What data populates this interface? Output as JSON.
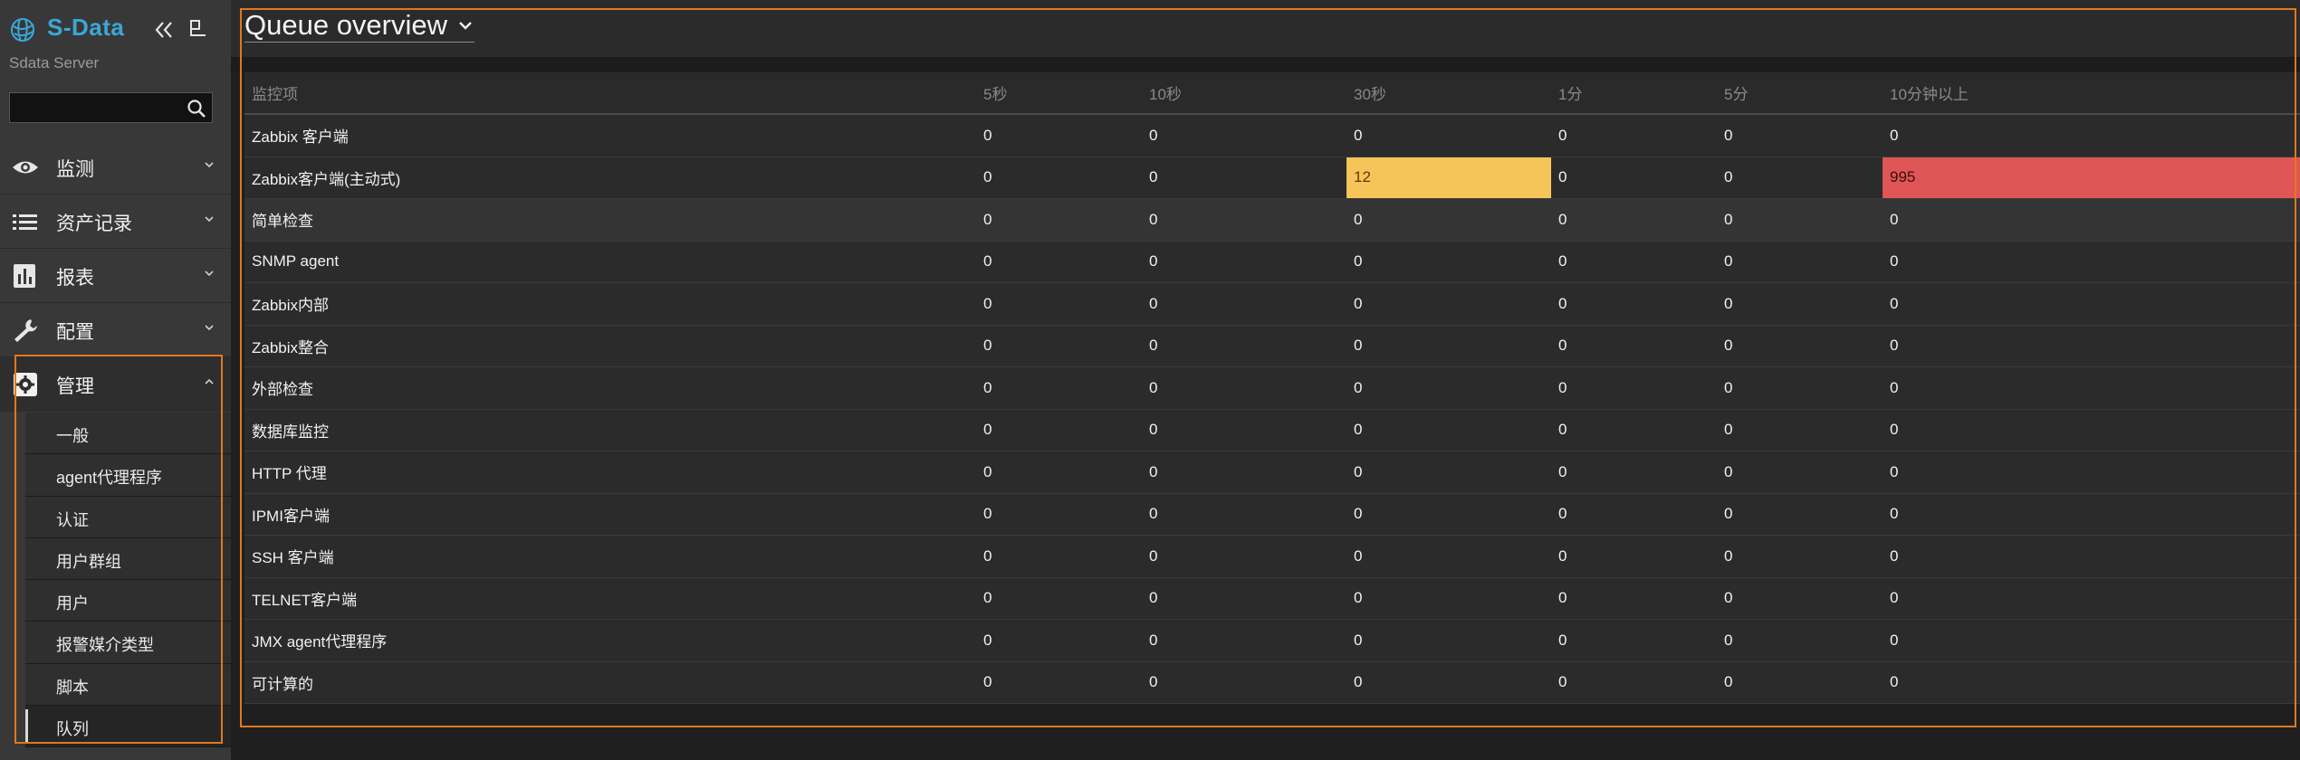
{
  "app": {
    "logo_text": "S-Data",
    "server_name": "Sdata Server",
    "search": {
      "value": "",
      "placeholder": ""
    }
  },
  "menu": [
    {
      "label": "监测",
      "icon": "eye-icon",
      "expanded": false
    },
    {
      "label": "资产记录",
      "icon": "list-icon",
      "expanded": false
    },
    {
      "label": "报表",
      "icon": "bar-chart-icon",
      "expanded": false
    },
    {
      "label": "配置",
      "icon": "wrench-icon",
      "expanded": false
    },
    {
      "label": "管理",
      "icon": "gear-icon",
      "expanded": true
    }
  ],
  "submenu": {
    "items": [
      {
        "label": "一般"
      },
      {
        "label": "agent代理程序"
      },
      {
        "label": "认证"
      },
      {
        "label": "用户群组"
      },
      {
        "label": "用户"
      },
      {
        "label": "报警媒介类型"
      },
      {
        "label": "脚本"
      },
      {
        "label": "队列",
        "selected": true
      }
    ]
  },
  "page": {
    "title": "Queue overview"
  },
  "table": {
    "headers": [
      "监控项",
      "5秒",
      "10秒",
      "30秒",
      "1分",
      "5分",
      "10分钟以上"
    ],
    "rows": [
      {
        "name": "Zabbix 客户端",
        "values": [
          "0",
          "0",
          "0",
          "0",
          "0",
          "0"
        ]
      },
      {
        "name": "Zabbix客户端(主动式)",
        "values": [
          "0",
          "0",
          "12",
          "0",
          "0",
          "995"
        ]
      },
      {
        "name": "简单检查",
        "values": [
          "0",
          "0",
          "0",
          "0",
          "0",
          "0"
        ]
      },
      {
        "name": "SNMP agent",
        "values": [
          "0",
          "0",
          "0",
          "0",
          "0",
          "0"
        ]
      },
      {
        "name": "Zabbix内部",
        "values": [
          "0",
          "0",
          "0",
          "0",
          "0",
          "0"
        ]
      },
      {
        "name": "Zabbix整合",
        "values": [
          "0",
          "0",
          "0",
          "0",
          "0",
          "0"
        ]
      },
      {
        "name": "外部检查",
        "values": [
          "0",
          "0",
          "0",
          "0",
          "0",
          "0"
        ]
      },
      {
        "name": "数据库监控",
        "values": [
          "0",
          "0",
          "0",
          "0",
          "0",
          "0"
        ]
      },
      {
        "name": "HTTP 代理",
        "values": [
          "0",
          "0",
          "0",
          "0",
          "0",
          "0"
        ]
      },
      {
        "name": "IPMI客户端",
        "values": [
          "0",
          "0",
          "0",
          "0",
          "0",
          "0"
        ]
      },
      {
        "name": "SSH 客户端",
        "values": [
          "0",
          "0",
          "0",
          "0",
          "0",
          "0"
        ]
      },
      {
        "name": "TELNET客户端",
        "values": [
          "0",
          "0",
          "0",
          "0",
          "0",
          "0"
        ]
      },
      {
        "name": "JMX agent代理程序",
        "values": [
          "0",
          "0",
          "0",
          "0",
          "0",
          "0"
        ]
      },
      {
        "name": "可计算的",
        "values": [
          "0",
          "0",
          "0",
          "0",
          "0",
          "0"
        ]
      }
    ]
  },
  "colors": {
    "accent_logo": "#3aa7d8",
    "warning": "#f6c55a",
    "critical": "#e05656",
    "highlight_outline": "#e0781d"
  }
}
